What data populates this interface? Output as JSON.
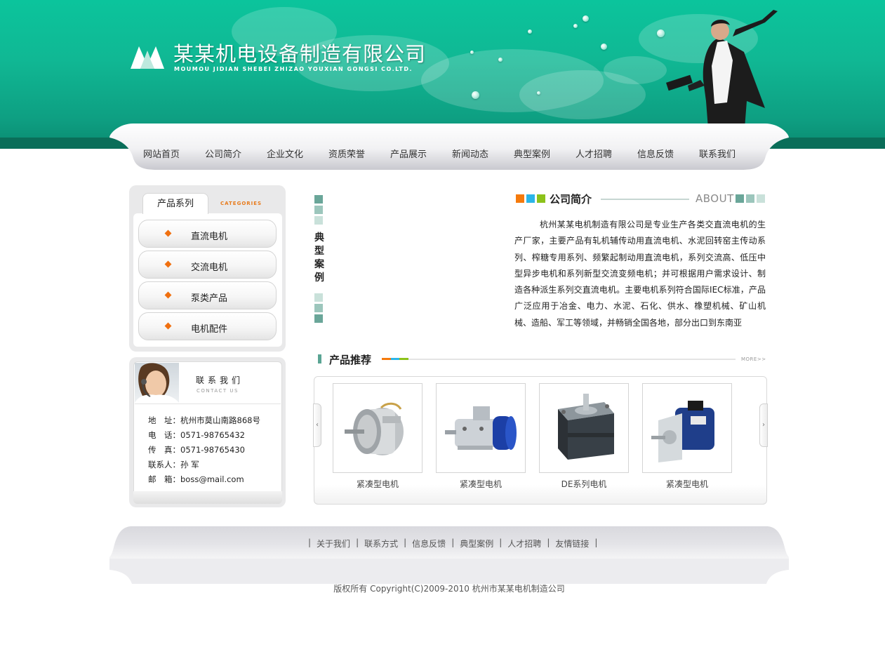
{
  "site": {
    "company_name": "某某机电设备制造有限公司",
    "company_name_en": "MOUMOU JIDIAN SHEBEI ZHIZAO YOUXIAN GONGSI CO.LTD."
  },
  "nav": {
    "items": [
      "网站首页",
      "公司简介",
      "企业文化",
      "资质荣誉",
      "产品展示",
      "新闻动态",
      "典型案例",
      "人才招聘",
      "信息反馈",
      "联系我们"
    ]
  },
  "categories": {
    "tab_label": "产品系列",
    "tab_label_en": "CATEGORIES",
    "items": [
      "直流电机",
      "交流电机",
      "泵类产品",
      "电机配件"
    ]
  },
  "contact": {
    "title": "联系我们",
    "title_en": "CONTACT US",
    "lines": [
      "地　址：杭州市莫山南路868号",
      "电　话：0571-98765432",
      "传　真：0571-98765430",
      "联系人：孙 军",
      "邮　箱：boss@mail.com"
    ]
  },
  "cases": {
    "label_chars": [
      "典",
      "型",
      "案",
      "例"
    ]
  },
  "about": {
    "title": "公司简介",
    "title_en": "ABOUT",
    "text": "杭州某某电机制造有限公司是专业生产各类交直流电机的生产厂家，主要产品有轧机辅传动用直流电机、水泥回转窑主传动系列、榨糖专用系列、频繁起制动用直流电机，系列交流高、低压中型异步电机和系列新型交流变频电机；并可根据用户需求设计、制造各种派生系列交直流电机。主要电机系列符合国际IEC标准，产品广泛应用于冶金、电力、水泥、石化、供水、橡塑机械、矿山机械、造船、军工等领域，并畅销全国各地，部分出口到东南亚"
  },
  "products": {
    "title": "产品推荐",
    "more": "MORE>>",
    "prev_arrow": "‹",
    "next_arrow": "›",
    "items": [
      {
        "name": "紧凑型电机",
        "icon": "silver-motor-image"
      },
      {
        "name": "紧凑型电机",
        "icon": "blue-gear-motor-image"
      },
      {
        "name": "DE系列电机",
        "icon": "stepper-motor-image"
      },
      {
        "name": "紧凑型电机",
        "icon": "blue-motor-image"
      }
    ]
  },
  "footer": {
    "links": [
      "关于我们",
      "联系方式",
      "信息反馈",
      "典型案例",
      "人才招聘",
      "友情链接"
    ],
    "copyright": "版权所有 Copyright(C)2009-2010 杭州市某某电机制造公司"
  },
  "colors": {
    "header_teal": "#0bc49c",
    "accent_orange": "#f07010",
    "sq_orange": "#f57a0c",
    "sq_blue": "#2bb5e8",
    "sq_green": "#8cc21a",
    "sq_teal": "#6aa699"
  }
}
